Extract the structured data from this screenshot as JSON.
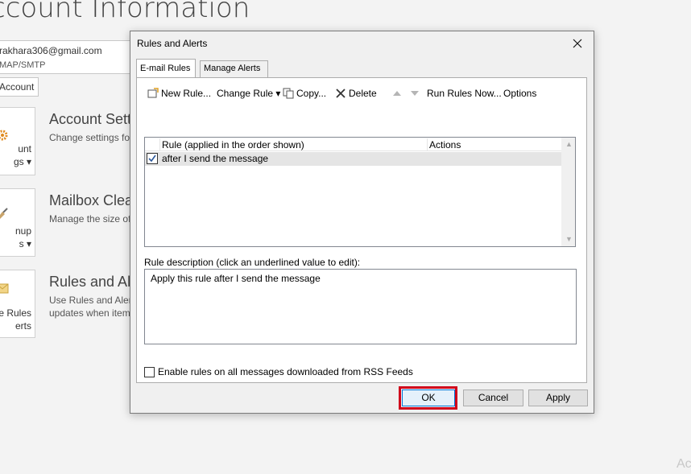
{
  "background": {
    "title": "ccount Information",
    "account_email": "rakhara306@gmail.com",
    "account_type": "MAP/SMTP",
    "add_account": "Account",
    "sections": [
      {
        "tile_line1": "unt",
        "tile_line2": "gs ▾",
        "title": "Account Sett",
        "desc1": "Change settings fo",
        "desc2": ""
      },
      {
        "tile_line1": "nup",
        "tile_line2": "s ▾",
        "title": "Mailbox Clea",
        "desc1": "Manage the size of",
        "desc2": ""
      },
      {
        "tile_line1": "e Rules",
        "tile_line2": "erts",
        "title": "Rules and Al",
        "desc1": "Use Rules and Alert",
        "desc2": "updates when item"
      }
    ],
    "watermark": "Ac"
  },
  "dialog": {
    "title": "Rules and Alerts",
    "tabs": [
      "E-mail Rules",
      "Manage Alerts"
    ],
    "toolbar": {
      "new_rule": "New Rule...",
      "change_rule": "Change Rule ▾",
      "copy": "Copy...",
      "delete": "Delete",
      "run_rules_now": "Run Rules Now...",
      "options": "Options"
    },
    "list": {
      "columns": [
        "Rule (applied in the order shown)",
        "Actions"
      ],
      "rows": [
        {
          "rule": "after I send the message",
          "checked": true
        }
      ]
    },
    "description_label": "Rule description (click an underlined value to edit):",
    "description_text": "Apply this rule after I send the message",
    "rss_label": "Enable rules on all messages downloaded from RSS Feeds",
    "buttons": {
      "ok": "OK",
      "cancel": "Cancel",
      "apply": "Apply"
    }
  },
  "colors": {
    "highlight": "#d0021b",
    "accent": "#0078d7"
  }
}
